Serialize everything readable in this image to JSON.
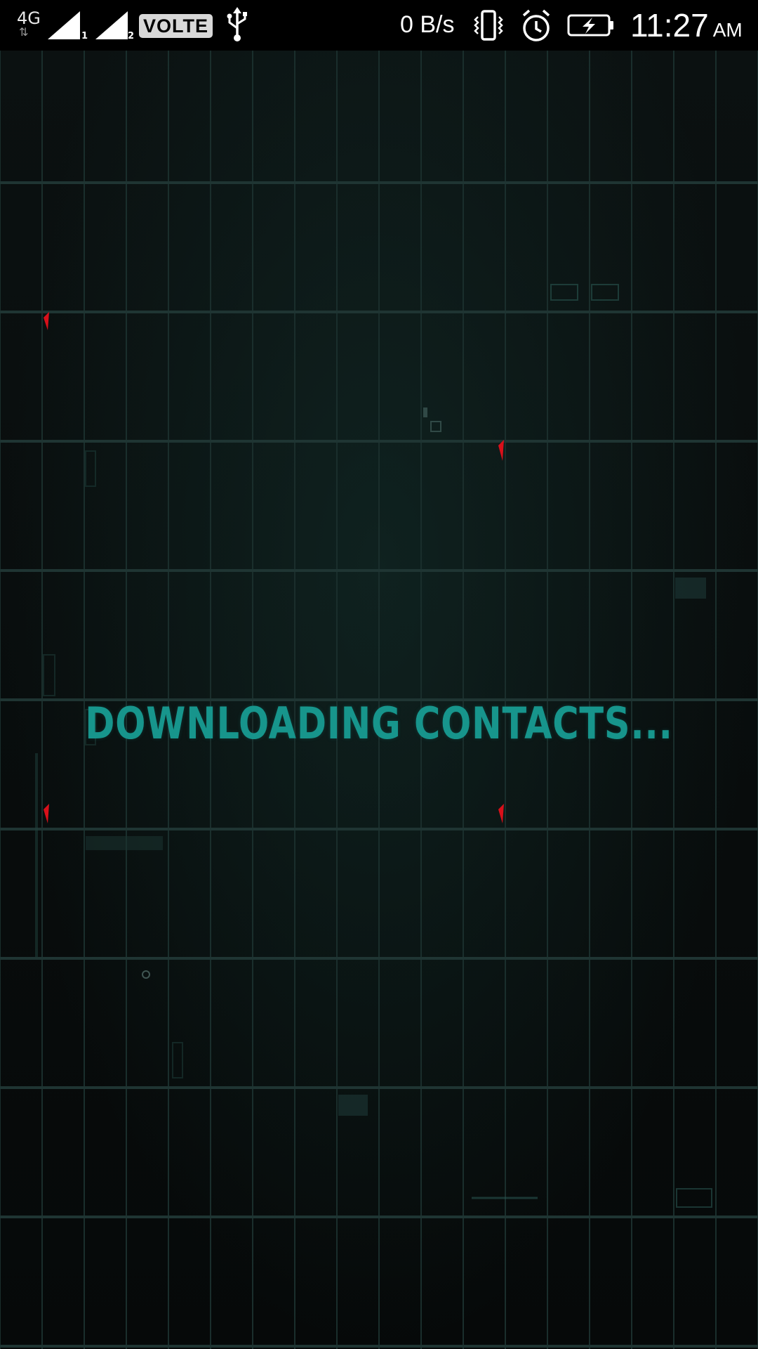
{
  "status_bar": {
    "network_type": "4G",
    "network_arrows": "⇅",
    "sim1_label": "1",
    "sim2_label": "2",
    "volte_label": "VOLTE",
    "data_speed": "0 B/s",
    "time": "11:27",
    "ampm": "AM",
    "icons": [
      "signal-icon",
      "usb-icon",
      "vibrate-icon",
      "alarm-icon",
      "battery-charging-icon"
    ]
  },
  "main": {
    "message": "DOWNLOADING CONTACTS..."
  },
  "colors": {
    "accent": "#17958c",
    "background": "#070a0a",
    "status_bar": "#000000",
    "marker_red": "#d8101a"
  }
}
